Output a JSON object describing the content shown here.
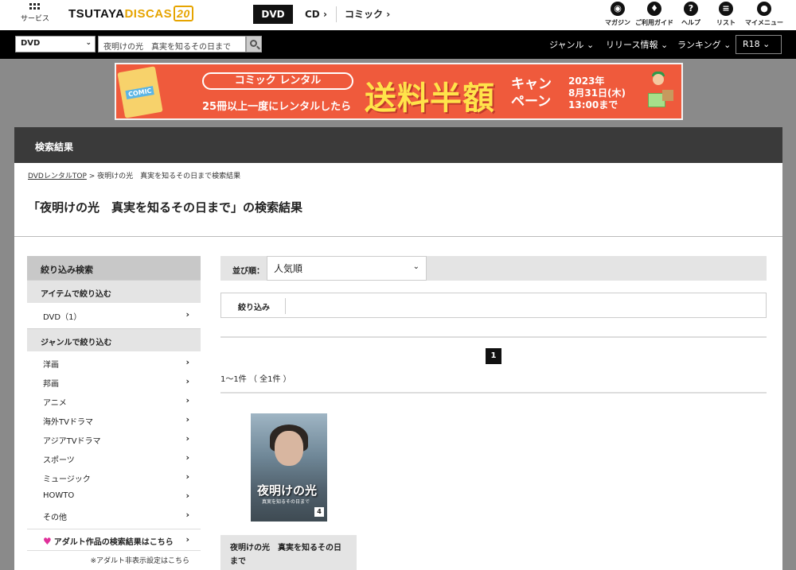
{
  "header": {
    "service_label": "サービス",
    "logo_part1": "TSUTAYA",
    "logo_part2": "DISCAS",
    "logo_badge": "20",
    "categories": [
      "DVD",
      "CD",
      "コミック"
    ],
    "chevron": "›",
    "nav": [
      {
        "label": "マガジン",
        "icon": "magazine-icon",
        "glyph": "◉"
      },
      {
        "label": "ご利用ガイド",
        "icon": "guide-icon",
        "glyph": "♦"
      },
      {
        "label": "ヘルプ",
        "icon": "help-icon",
        "glyph": "?"
      },
      {
        "label": "リスト",
        "icon": "list-icon",
        "glyph": "≡"
      },
      {
        "label": "マイメニュー",
        "icon": "user-icon",
        "glyph": "●"
      }
    ]
  },
  "search": {
    "select_value": "DVD",
    "query": "夜明けの光　真実を知るその日まで",
    "nav": [
      "ジャンル ⌄",
      "リリース情報 ⌄",
      "ランキング ⌄"
    ],
    "r18": "R18 ⌄"
  },
  "banner": {
    "comic_tag": "COMIC",
    "pill": "コミック レンタル",
    "sub": "25冊以上一度にレンタルしたら",
    "big": "送料半額",
    "campaign": "キャンペーン",
    "date_year": "2023年",
    "date_day": "8月31日(木)",
    "date_time": "13:00まで"
  },
  "main": {
    "heading": "検索結果",
    "breadcrumb_home": "DVDレンタルTOP",
    "breadcrumb_current": " > 夜明けの光　真実を知るその日まで検索結果",
    "title": "「夜明けの光　真実を知るその日まで」の検索結果"
  },
  "sidebar": {
    "header": "絞り込み検索",
    "item_section": "アイテムで絞り込む",
    "item_dvd": "DVD（1）",
    "genre_section": "ジャンルで絞り込む",
    "genres": [
      "洋画",
      "邦画",
      "アニメ",
      "海外TVドラマ",
      "アジアTVドラマ",
      "スポーツ",
      "ミュージック",
      "HOWTO",
      "その他"
    ],
    "adult_link": "アダルト作品の検索結果はこちら",
    "hide_setting": "※アダルト非表示設定はこちら",
    "arrow": "›",
    "heart": "♥"
  },
  "content": {
    "sort_label": "並び順：",
    "sort_value": "人気順",
    "sort_chevron": "⌄",
    "filter_label": "絞り込み",
    "page": "1",
    "count": "1〜1件 （ 全1件 ）",
    "product": {
      "cover_title": "夜明けの光",
      "cover_sub": "真実を知るその日まで",
      "cover_vol": "4",
      "title": "夜明けの光　真実を知るその日まで"
    }
  }
}
